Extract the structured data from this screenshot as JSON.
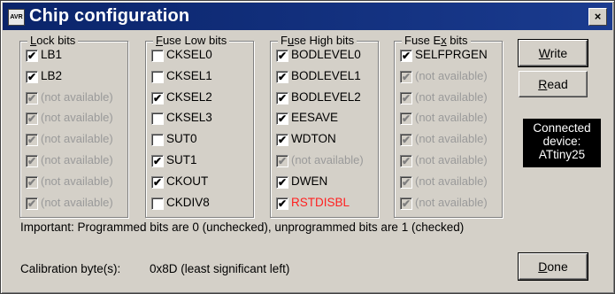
{
  "window": {
    "title": "Chip configuration",
    "icon_label": "AVR",
    "close_label": "×"
  },
  "groups": [
    {
      "title_ul": "L",
      "title_rest": "ock bits",
      "items": [
        {
          "label": "LB1",
          "checked": true,
          "enabled": true,
          "color": "normal"
        },
        {
          "label": "LB2",
          "checked": true,
          "enabled": true,
          "color": "normal"
        },
        {
          "label": "(not available)",
          "checked": true,
          "enabled": false,
          "color": "normal"
        },
        {
          "label": "(not available)",
          "checked": true,
          "enabled": false,
          "color": "normal"
        },
        {
          "label": "(not available)",
          "checked": true,
          "enabled": false,
          "color": "normal"
        },
        {
          "label": "(not available)",
          "checked": true,
          "enabled": false,
          "color": "normal"
        },
        {
          "label": "(not available)",
          "checked": true,
          "enabled": false,
          "color": "normal"
        },
        {
          "label": "(not available)",
          "checked": true,
          "enabled": false,
          "color": "normal"
        }
      ]
    },
    {
      "title_ul": "F",
      "title_rest": "use Low bits",
      "items": [
        {
          "label": "CKSEL0",
          "checked": false,
          "enabled": true,
          "color": "normal"
        },
        {
          "label": "CKSEL1",
          "checked": false,
          "enabled": true,
          "color": "normal"
        },
        {
          "label": "CKSEL2",
          "checked": true,
          "enabled": true,
          "color": "normal"
        },
        {
          "label": "CKSEL3",
          "checked": false,
          "enabled": true,
          "color": "normal"
        },
        {
          "label": "SUT0",
          "checked": false,
          "enabled": true,
          "color": "normal"
        },
        {
          "label": "SUT1",
          "checked": true,
          "enabled": true,
          "color": "normal"
        },
        {
          "label": "CKOUT",
          "checked": true,
          "enabled": true,
          "color": "normal"
        },
        {
          "label": "CKDIV8",
          "checked": false,
          "enabled": true,
          "color": "normal"
        }
      ]
    },
    {
      "title_pre": "F",
      "title_ul": "u",
      "title_rest": "se High bits",
      "items": [
        {
          "label": "BODLEVEL0",
          "checked": true,
          "enabled": true,
          "color": "normal"
        },
        {
          "label": "BODLEVEL1",
          "checked": true,
          "enabled": true,
          "color": "normal"
        },
        {
          "label": "BODLEVEL2",
          "checked": true,
          "enabled": true,
          "color": "normal"
        },
        {
          "label": "EESAVE",
          "checked": true,
          "enabled": true,
          "color": "normal"
        },
        {
          "label": "WDTON",
          "checked": true,
          "enabled": true,
          "color": "normal"
        },
        {
          "label": "(not available)",
          "checked": true,
          "enabled": false,
          "color": "normal"
        },
        {
          "label": "DWEN",
          "checked": true,
          "enabled": true,
          "color": "normal"
        },
        {
          "label": "RSTDISBL",
          "checked": true,
          "enabled": true,
          "color": "#ff2020"
        }
      ]
    },
    {
      "title_pre": "Fuse E",
      "title_ul": "x",
      "title_rest": " bits",
      "items": [
        {
          "label": "SELFPRGEN",
          "checked": true,
          "enabled": true,
          "color": "normal"
        },
        {
          "label": "(not available)",
          "checked": true,
          "enabled": false,
          "color": "normal"
        },
        {
          "label": "(not available)",
          "checked": true,
          "enabled": false,
          "color": "normal"
        },
        {
          "label": "(not available)",
          "checked": true,
          "enabled": false,
          "color": "normal"
        },
        {
          "label": "(not available)",
          "checked": true,
          "enabled": false,
          "color": "normal"
        },
        {
          "label": "(not available)",
          "checked": true,
          "enabled": false,
          "color": "normal"
        },
        {
          "label": "(not available)",
          "checked": true,
          "enabled": false,
          "color": "normal"
        },
        {
          "label": "(not available)",
          "checked": true,
          "enabled": false,
          "color": "normal"
        }
      ]
    }
  ],
  "buttons": {
    "write_ul": "W",
    "write_rest": "rite",
    "read_ul": "R",
    "read_rest": "ead",
    "done_ul": "D",
    "done_rest": "one"
  },
  "status": {
    "line1": "Connected",
    "line2": "device:",
    "line3": "ATtiny25"
  },
  "note": "Important: Programmed bits are 0 (unchecked), unprogrammed bits are 1 (checked)",
  "calibration": {
    "label": "Calibration byte(s):",
    "value": "0x8D (least significant left)"
  },
  "colors": {
    "titlebar": "#0a246a",
    "face": "#d4d0c8",
    "warning_label": "#ff2020"
  }
}
